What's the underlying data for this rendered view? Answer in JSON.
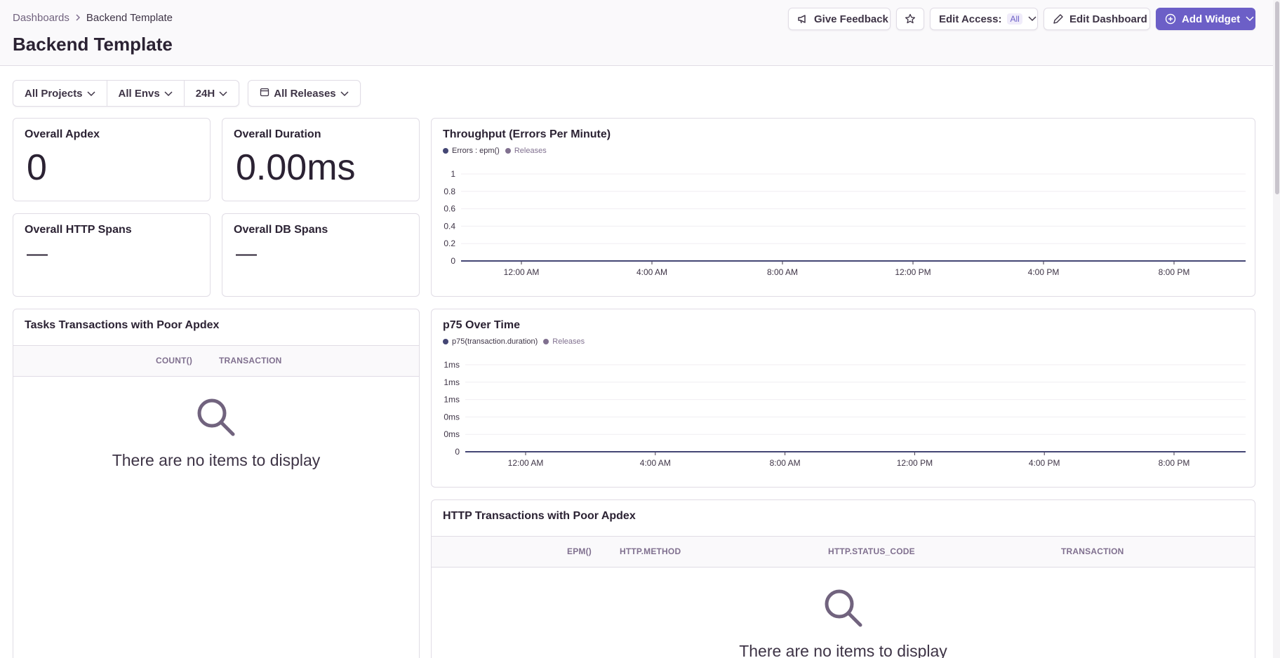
{
  "breadcrumb": {
    "parent": "Dashboards",
    "current": "Backend Template"
  },
  "page": {
    "title": "Backend Template"
  },
  "header_actions": {
    "feedback_label": "Give Feedback",
    "edit_access_label": "Edit Access:",
    "edit_access_value": "All",
    "edit_dashboard_label": "Edit Dashboard",
    "add_widget_label": "Add Widget"
  },
  "filters": {
    "projects": "All Projects",
    "envs": "All Envs",
    "period": "24H",
    "releases": "All Releases"
  },
  "widgets": {
    "apdex": {
      "title": "Overall Apdex",
      "value": "0"
    },
    "duration": {
      "title": "Overall Duration",
      "value": "0.00ms"
    },
    "http_spans": {
      "title": "Overall HTTP Spans",
      "value": "—"
    },
    "db_spans": {
      "title": "Overall DB Spans",
      "value": "—"
    },
    "throughput": {
      "title": "Throughput (Errors Per Minute)",
      "legend_series": "Errors : epm()",
      "legend_releases": "Releases"
    },
    "p75": {
      "title": "p75 Over Time",
      "legend_series": "p75(transaction.duration)",
      "legend_releases": "Releases"
    },
    "tasks_table": {
      "title": "Tasks Transactions with Poor Apdex",
      "columns": [
        "COUNT()",
        "TRANSACTION"
      ],
      "empty_message": "There are no items to display"
    },
    "http_table": {
      "title": "HTTP Transactions with Poor Apdex",
      "columns": [
        "EPM()",
        "HTTP.METHOD",
        "HTTP.STATUS_CODE",
        "TRANSACTION"
      ],
      "empty_message": "There are no items to display"
    }
  },
  "colors": {
    "accent": "#6c5fc7",
    "series_line": "#444674",
    "releases_dot": "#80708f",
    "text": "#2b2233"
  },
  "chart_data": [
    {
      "type": "line",
      "title": "Throughput (Errors Per Minute)",
      "x": [
        "12:00 AM",
        "4:00 AM",
        "8:00 AM",
        "12:00 PM",
        "4:00 PM",
        "8:00 PM"
      ],
      "series": [
        {
          "name": "Errors : epm()",
          "values": [
            0,
            0,
            0,
            0,
            0,
            0
          ]
        },
        {
          "name": "Releases",
          "values": []
        }
      ],
      "y_ticks": [
        "0",
        "0.2",
        "0.4",
        "0.6",
        "0.8",
        "1"
      ],
      "ylim": [
        0,
        1
      ],
      "legend": "top-left",
      "grid": true
    },
    {
      "type": "line",
      "title": "p75 Over Time",
      "x": [
        "12:00 AM",
        "4:00 AM",
        "8:00 AM",
        "12:00 PM",
        "4:00 PM",
        "8:00 PM"
      ],
      "series": [
        {
          "name": "p75(transaction.duration)",
          "values": [
            0,
            0,
            0,
            0,
            0,
            0
          ]
        },
        {
          "name": "Releases",
          "values": []
        }
      ],
      "y_ticks": [
        "0",
        "0ms",
        "0ms",
        "1ms",
        "1ms",
        "1ms"
      ],
      "legend": "top-left",
      "grid": true
    }
  ]
}
